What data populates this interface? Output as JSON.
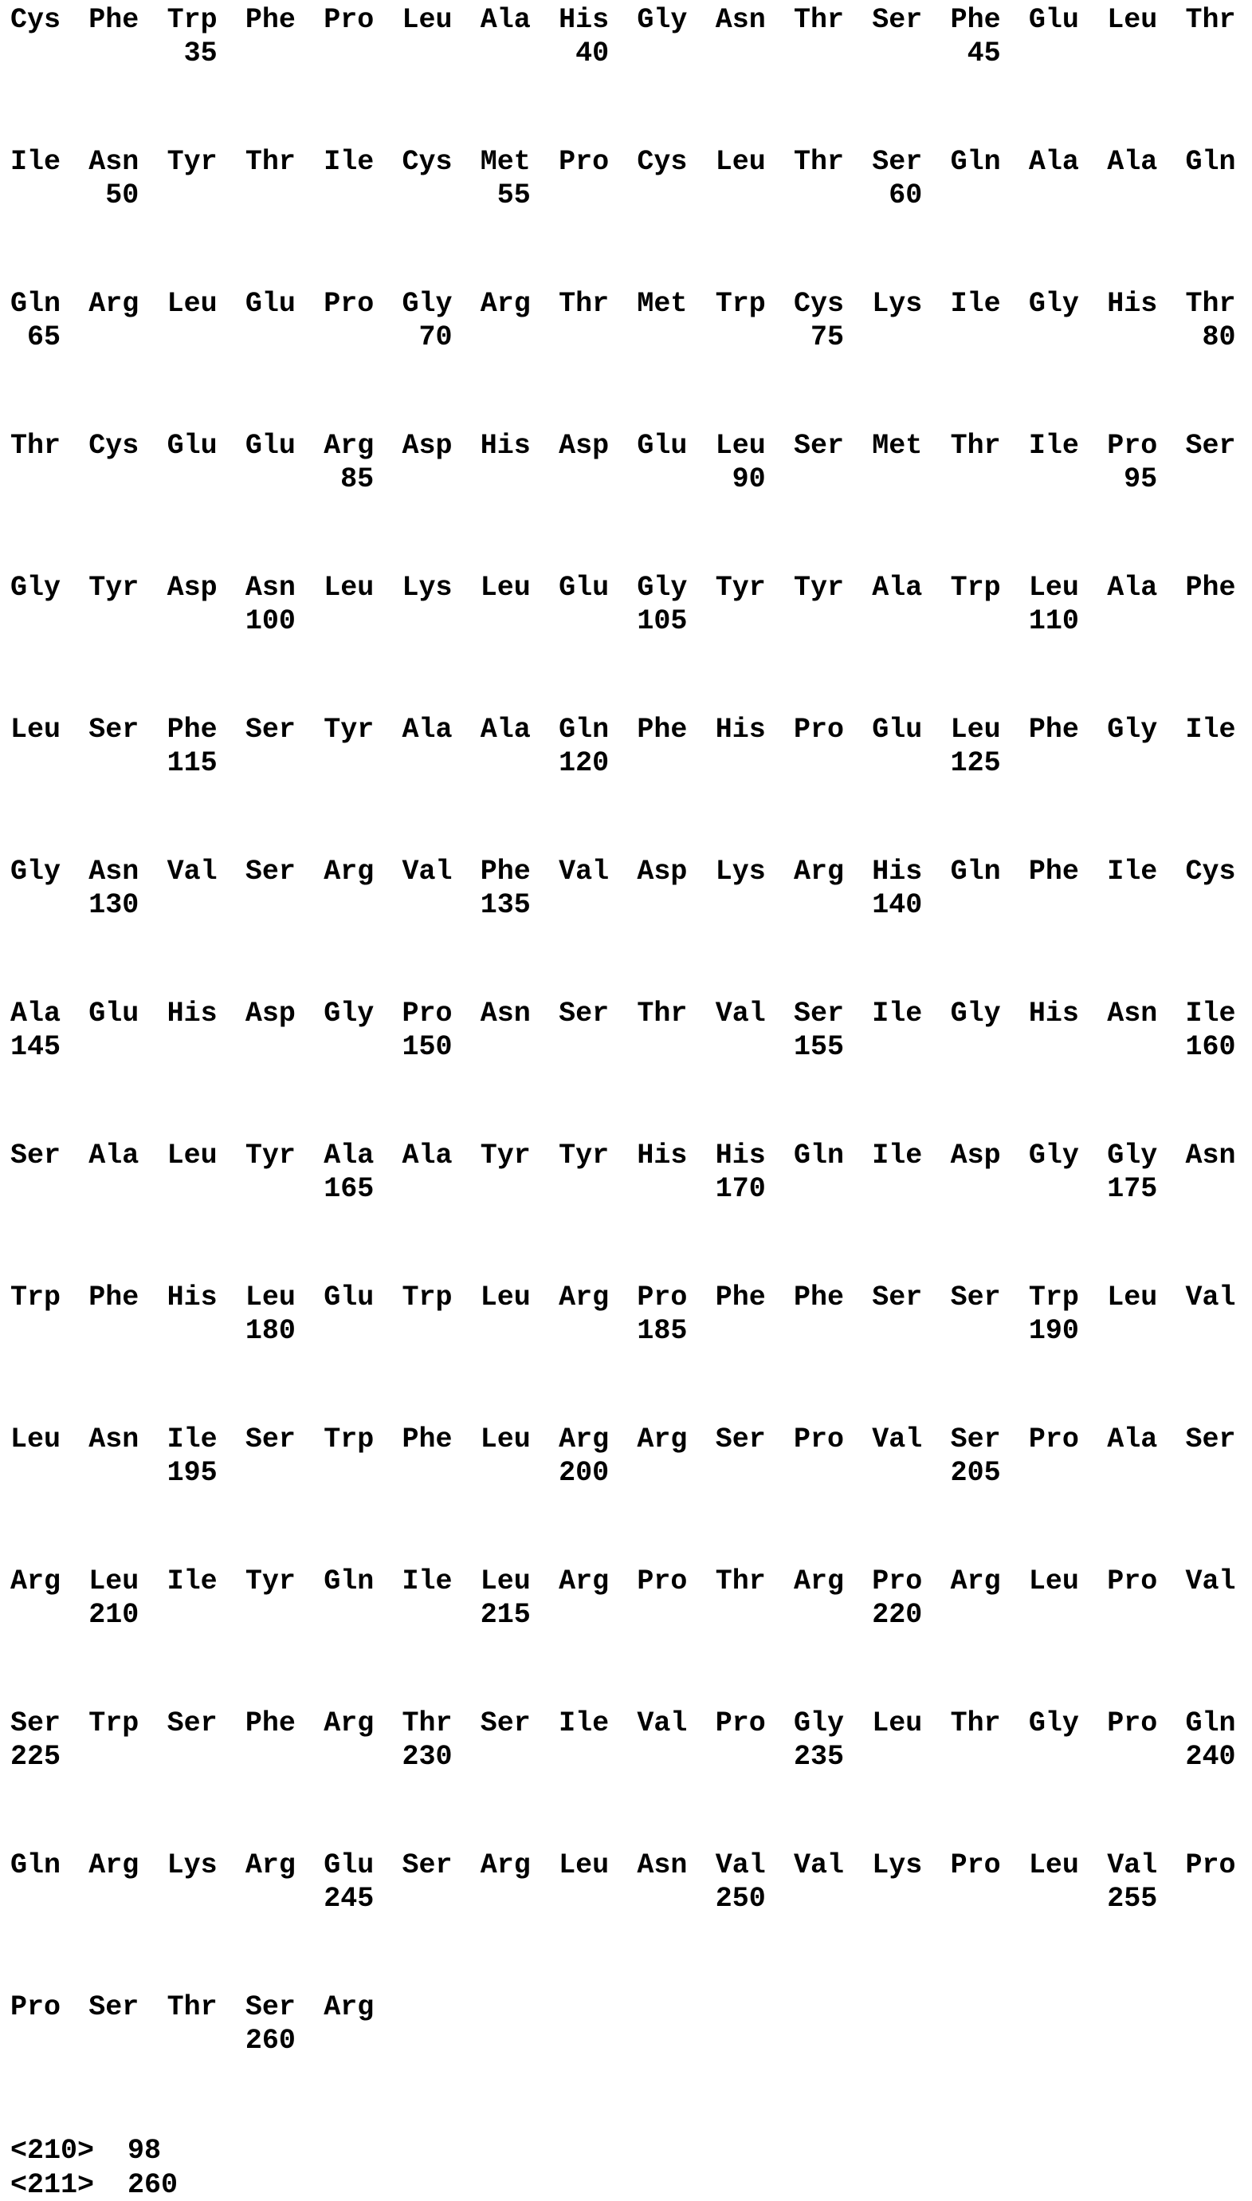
{
  "sequence_rows": [
    {
      "residues": [
        "Cys",
        "Phe",
        "Trp",
        "Phe",
        "Pro",
        "Leu",
        "Ala",
        "His",
        "Gly",
        "Asn",
        "Thr",
        "Ser",
        "Phe",
        "Glu",
        "Leu",
        "Thr"
      ],
      "numbers": [
        {
          "col": 2,
          "value": "35"
        },
        {
          "col": 7,
          "value": "40"
        },
        {
          "col": 12,
          "value": "45"
        }
      ]
    },
    {
      "residues": [
        "Ile",
        "Asn",
        "Tyr",
        "Thr",
        "Ile",
        "Cys",
        "Met",
        "Pro",
        "Cys",
        "Leu",
        "Thr",
        "Ser",
        "Gln",
        "Ala",
        "Ala",
        "Gln"
      ],
      "numbers": [
        {
          "col": 1,
          "value": "50"
        },
        {
          "col": 6,
          "value": "55"
        },
        {
          "col": 11,
          "value": "60"
        }
      ]
    },
    {
      "residues": [
        "Gln",
        "Arg",
        "Leu",
        "Glu",
        "Pro",
        "Gly",
        "Arg",
        "Thr",
        "Met",
        "Trp",
        "Cys",
        "Lys",
        "Ile",
        "Gly",
        "His",
        "Thr"
      ],
      "numbers": [
        {
          "col": 0,
          "value": "65"
        },
        {
          "col": 5,
          "value": "70"
        },
        {
          "col": 10,
          "value": "75"
        },
        {
          "col": 15,
          "value": "80"
        }
      ]
    },
    {
      "residues": [
        "Thr",
        "Cys",
        "Glu",
        "Glu",
        "Arg",
        "Asp",
        "His",
        "Asp",
        "Glu",
        "Leu",
        "Ser",
        "Met",
        "Thr",
        "Ile",
        "Pro",
        "Ser"
      ],
      "numbers": [
        {
          "col": 4,
          "value": "85"
        },
        {
          "col": 9,
          "value": "90"
        },
        {
          "col": 14,
          "value": "95"
        }
      ]
    },
    {
      "residues": [
        "Gly",
        "Tyr",
        "Asp",
        "Asn",
        "Leu",
        "Lys",
        "Leu",
        "Glu",
        "Gly",
        "Tyr",
        "Tyr",
        "Ala",
        "Trp",
        "Leu",
        "Ala",
        "Phe"
      ],
      "numbers": [
        {
          "col": 3,
          "value": "100"
        },
        {
          "col": 8,
          "value": "105"
        },
        {
          "col": 13,
          "value": "110"
        }
      ]
    },
    {
      "residues": [
        "Leu",
        "Ser",
        "Phe",
        "Ser",
        "Tyr",
        "Ala",
        "Ala",
        "Gln",
        "Phe",
        "His",
        "Pro",
        "Glu",
        "Leu",
        "Phe",
        "Gly",
        "Ile"
      ],
      "numbers": [
        {
          "col": 2,
          "value": "115"
        },
        {
          "col": 7,
          "value": "120"
        },
        {
          "col": 12,
          "value": "125"
        }
      ]
    },
    {
      "residues": [
        "Gly",
        "Asn",
        "Val",
        "Ser",
        "Arg",
        "Val",
        "Phe",
        "Val",
        "Asp",
        "Lys",
        "Arg",
        "His",
        "Gln",
        "Phe",
        "Ile",
        "Cys"
      ],
      "numbers": [
        {
          "col": 1,
          "value": "130"
        },
        {
          "col": 6,
          "value": "135"
        },
        {
          "col": 11,
          "value": "140"
        }
      ]
    },
    {
      "residues": [
        "Ala",
        "Glu",
        "His",
        "Asp",
        "Gly",
        "Pro",
        "Asn",
        "Ser",
        "Thr",
        "Val",
        "Ser",
        "Ile",
        "Gly",
        "His",
        "Asn",
        "Ile"
      ],
      "numbers": [
        {
          "col": 0,
          "value": "145"
        },
        {
          "col": 5,
          "value": "150"
        },
        {
          "col": 10,
          "value": "155"
        },
        {
          "col": 15,
          "value": "160"
        }
      ]
    },
    {
      "residues": [
        "Ser",
        "Ala",
        "Leu",
        "Tyr",
        "Ala",
        "Ala",
        "Tyr",
        "Tyr",
        "His",
        "His",
        "Gln",
        "Ile",
        "Asp",
        "Gly",
        "Gly",
        "Asn"
      ],
      "numbers": [
        {
          "col": 4,
          "value": "165"
        },
        {
          "col": 9,
          "value": "170"
        },
        {
          "col": 14,
          "value": "175"
        }
      ]
    },
    {
      "residues": [
        "Trp",
        "Phe",
        "His",
        "Leu",
        "Glu",
        "Trp",
        "Leu",
        "Arg",
        "Pro",
        "Phe",
        "Phe",
        "Ser",
        "Ser",
        "Trp",
        "Leu",
        "Val"
      ],
      "numbers": [
        {
          "col": 3,
          "value": "180"
        },
        {
          "col": 8,
          "value": "185"
        },
        {
          "col": 13,
          "value": "190"
        }
      ]
    },
    {
      "residues": [
        "Leu",
        "Asn",
        "Ile",
        "Ser",
        "Trp",
        "Phe",
        "Leu",
        "Arg",
        "Arg",
        "Ser",
        "Pro",
        "Val",
        "Ser",
        "Pro",
        "Ala",
        "Ser"
      ],
      "numbers": [
        {
          "col": 2,
          "value": "195"
        },
        {
          "col": 7,
          "value": "200"
        },
        {
          "col": 12,
          "value": "205"
        }
      ]
    },
    {
      "residues": [
        "Arg",
        "Leu",
        "Ile",
        "Tyr",
        "Gln",
        "Ile",
        "Leu",
        "Arg",
        "Pro",
        "Thr",
        "Arg",
        "Pro",
        "Arg",
        "Leu",
        "Pro",
        "Val"
      ],
      "numbers": [
        {
          "col": 1,
          "value": "210"
        },
        {
          "col": 6,
          "value": "215"
        },
        {
          "col": 11,
          "value": "220"
        }
      ]
    },
    {
      "residues": [
        "Ser",
        "Trp",
        "Ser",
        "Phe",
        "Arg",
        "Thr",
        "Ser",
        "Ile",
        "Val",
        "Pro",
        "Gly",
        "Leu",
        "Thr",
        "Gly",
        "Pro",
        "Gln"
      ],
      "numbers": [
        {
          "col": 0,
          "value": "225"
        },
        {
          "col": 5,
          "value": "230"
        },
        {
          "col": 10,
          "value": "235"
        },
        {
          "col": 15,
          "value": "240"
        }
      ]
    },
    {
      "residues": [
        "Gln",
        "Arg",
        "Lys",
        "Arg",
        "Glu",
        "Ser",
        "Arg",
        "Leu",
        "Asn",
        "Val",
        "Val",
        "Lys",
        "Pro",
        "Leu",
        "Val",
        "Pro"
      ],
      "numbers": [
        {
          "col": 4,
          "value": "245"
        },
        {
          "col": 9,
          "value": "250"
        },
        {
          "col": 14,
          "value": "255"
        }
      ]
    },
    {
      "residues": [
        "Pro",
        "Ser",
        "Thr",
        "Ser",
        "Arg"
      ],
      "numbers": [
        {
          "col": 3,
          "value": "260"
        }
      ]
    }
  ],
  "metadata": [
    {
      "tag": "<210>",
      "value": "98"
    },
    {
      "tag": "<211>",
      "value": "260"
    }
  ]
}
